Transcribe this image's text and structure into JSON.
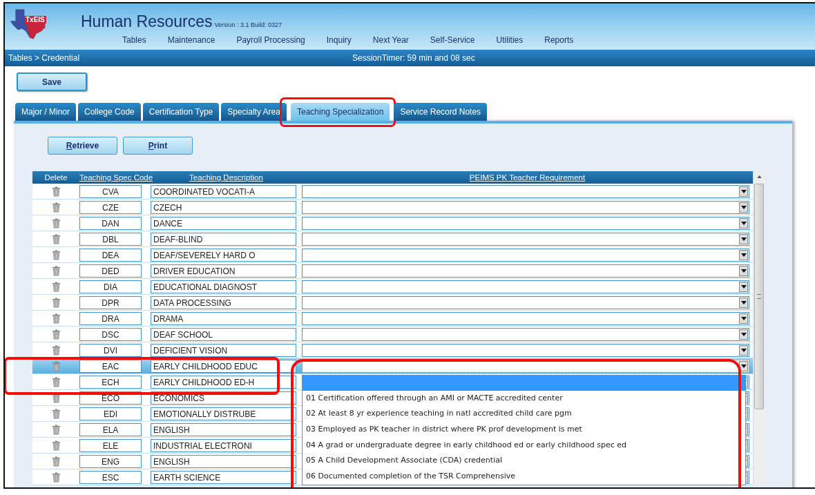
{
  "header": {
    "logo_text": "TxEIS",
    "title": "Human Resources",
    "version": "Version : 3.1 Build: 0327",
    "menu": [
      "Tables",
      "Maintenance",
      "Payroll Processing",
      "Inquiry",
      "Next Year",
      "Self-Service",
      "Utilities",
      "Reports"
    ]
  },
  "breadcrumb": "Tables > Credential",
  "session_timer": "SessionTimer: 59 min and 08 sec",
  "save_button": "Save",
  "tabs": [
    {
      "label": "Major / Minor",
      "selected": false,
      "highlighted": false
    },
    {
      "label": "College Code",
      "selected": false,
      "highlighted": false
    },
    {
      "label": "Certification Type",
      "selected": false,
      "highlighted": false
    },
    {
      "label": "Specialty Area",
      "selected": false,
      "highlighted": false
    },
    {
      "label": "Teaching Specialization",
      "selected": true,
      "highlighted": true
    },
    {
      "label": "Service Record Notes",
      "selected": false,
      "highlighted": false
    }
  ],
  "actions": [
    {
      "label": "Retrieve",
      "underline_first_letter": true
    },
    {
      "label": "Print",
      "underline_first_letter": true
    }
  ],
  "table": {
    "columns": [
      {
        "label": "Delete",
        "sortable": false
      },
      {
        "label": "Teaching Spec Code",
        "sortable": true
      },
      {
        "label": "Teaching Description",
        "sortable": true
      },
      {
        "label": "PEIMS PK Teacher Requirement",
        "sortable": true
      }
    ],
    "rows": [
      {
        "code": "CVA",
        "description": "COORDINATED VOCATI-A",
        "selected": false,
        "highlighted": false,
        "dropdown_open": false
      },
      {
        "code": "CZE",
        "description": "CZECH",
        "selected": false,
        "highlighted": false,
        "dropdown_open": false
      },
      {
        "code": "DAN",
        "description": "DANCE",
        "selected": false,
        "highlighted": false,
        "dropdown_open": false
      },
      {
        "code": "DBL",
        "description": "DEAF-BLIND",
        "selected": false,
        "highlighted": false,
        "dropdown_open": false
      },
      {
        "code": "DEA",
        "description": "DEAF/SEVERELY HARD O",
        "selected": false,
        "highlighted": false,
        "dropdown_open": false
      },
      {
        "code": "DED",
        "description": "DRIVER EDUCATION",
        "selected": false,
        "highlighted": false,
        "dropdown_open": false
      },
      {
        "code": "DIA",
        "description": "EDUCATIONAL DIAGNOST",
        "selected": false,
        "highlighted": false,
        "dropdown_open": false
      },
      {
        "code": "DPR",
        "description": "DATA PROCESSING",
        "selected": false,
        "highlighted": false,
        "dropdown_open": false
      },
      {
        "code": "DRA",
        "description": "DRAMA",
        "selected": false,
        "highlighted": false,
        "dropdown_open": false
      },
      {
        "code": "DSC",
        "description": "DEAF SCHOOL",
        "selected": false,
        "highlighted": false,
        "dropdown_open": false
      },
      {
        "code": "DVI",
        "description": "DEFICIENT VISION",
        "selected": false,
        "highlighted": false,
        "dropdown_open": false
      },
      {
        "code": "EAC",
        "description": "EARLY CHILDHOOD EDUC",
        "selected": true,
        "highlighted": true,
        "dropdown_open": true
      },
      {
        "code": "ECH",
        "description": "EARLY CHILDHOOD ED-H",
        "selected": false,
        "highlighted": true,
        "dropdown_open": false
      },
      {
        "code": "ECO",
        "description": "ECONOMICS",
        "selected": false,
        "highlighted": false,
        "dropdown_open": false
      },
      {
        "code": "EDI",
        "description": "EMOTIONALLY DISTRUBE",
        "selected": false,
        "highlighted": false,
        "dropdown_open": false
      },
      {
        "code": "ELA",
        "description": "ENGLISH",
        "selected": false,
        "highlighted": false,
        "dropdown_open": false
      },
      {
        "code": "ELE",
        "description": "INDUSTRIAL ELECTRONI",
        "selected": false,
        "highlighted": false,
        "dropdown_open": false
      },
      {
        "code": "ENG",
        "description": "ENGLISH",
        "selected": false,
        "highlighted": false,
        "dropdown_open": false
      },
      {
        "code": "ESC",
        "description": "EARTH SCIENCE",
        "selected": false,
        "highlighted": false,
        "dropdown_open": false
      }
    ]
  },
  "dropdown": {
    "highlighted": true,
    "blank_selected": true,
    "options": [
      "01 Certification offered through an AMI or MACTE accredited center",
      "02 At least 8 yr experience teaching in natl accredited child care pgm",
      "03 Employed as PK teacher in district where PK prof development is met",
      "04 A grad or undergraduate degree in early childhood ed or early childhood spec ed",
      "05 A Child Development Associate (CDA) credential",
      "06 Documented completion of the TSR Comprehensive"
    ]
  }
}
